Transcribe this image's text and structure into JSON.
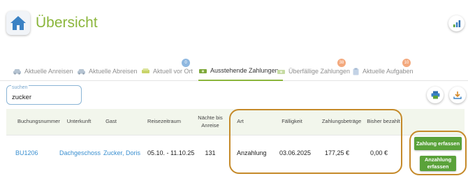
{
  "header": {
    "title": "Übersicht"
  },
  "tabs": [
    {
      "label": "Aktuelle Anreisen",
      "icon": "car-icon",
      "badge": ""
    },
    {
      "label": "Aktuelle Abreisen",
      "icon": "car-icon",
      "badge": ""
    },
    {
      "label": "Aktuell vor Ort",
      "icon": "sofa-icon",
      "badge": "0"
    },
    {
      "label": "Ausstehende Zahlungen",
      "icon": "money-icon",
      "badge": ""
    },
    {
      "label": "Überfällige Zahlungen",
      "icon": "money-icon",
      "badge": "38"
    },
    {
      "label": "Aktuelle Aufgaben",
      "icon": "clipboard-icon",
      "badge": "10"
    }
  ],
  "active_tab": "Ausstehende Zahlungen",
  "search": {
    "label": "suchen",
    "value": "zucker"
  },
  "table": {
    "columns": [
      "Buchungsnummer",
      "Unterkunft",
      "Gast",
      "Reisezeitraum",
      "Nächte bis Anreise",
      "Art",
      "Fälligkeit",
      "Zahlungsbeträge",
      "Bisher bezahlt"
    ],
    "row": {
      "booking_number": "BU1206",
      "accommodation": "Dachgeschoss",
      "guest": "Zucker, Doris",
      "period": "05.10. - 11.10.25",
      "nights_until_arrival": "131",
      "type": "Anzahlung",
      "due_date": "03.06.2025",
      "amount": "177,25 €",
      "paid_so_far": "0,00 €"
    }
  },
  "actions": {
    "payment_button": "Zahlung erfassen",
    "deposit_button": "Anzahlung erfassen"
  },
  "colors": {
    "brand_green": "#8bb63c",
    "button_green": "#5aa23a",
    "link_blue": "#3a8fd0",
    "highlight": "#c58a2a",
    "badge_blue": "#8fb8e0",
    "badge_orange": "#f3a97e"
  }
}
